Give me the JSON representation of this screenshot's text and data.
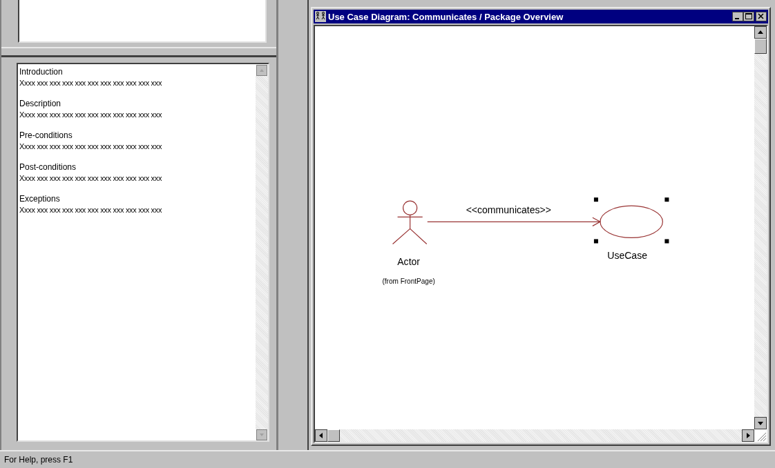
{
  "documentation": {
    "sections": [
      {
        "heading": "Introduction",
        "text": "Xxxx xxx xxx xxx xxx xxx xxx xxx xxx xxx xxx"
      },
      {
        "heading": "Description",
        "text": "Xxxx xxx xxx xxx xxx xxx xxx xxx xxx xxx xxx"
      },
      {
        "heading": "Pre-conditions",
        "text": "Xxxx xxx xxx xxx xxx xxx xxx xxx xxx xxx xxx"
      },
      {
        "heading": "Post-conditions",
        "text": "Xxxx xxx xxx xxx xxx xxx xxx xxx xxx xxx xxx"
      },
      {
        "heading": "Exceptions",
        "text": "Xxxx xxx xxx xxx xxx xxx xxx xxx xxx xxx xxx"
      }
    ]
  },
  "diagram_window": {
    "title": "Use Case Diagram: Communicates / Package Overview",
    "actor": {
      "name": "Actor",
      "origin": "(from FrontPage)"
    },
    "association": {
      "stereotype": "<<communicates>>"
    },
    "use_case": {
      "name": "UseCase",
      "selected": true
    }
  },
  "status_bar": {
    "text": "For Help, press F1"
  }
}
